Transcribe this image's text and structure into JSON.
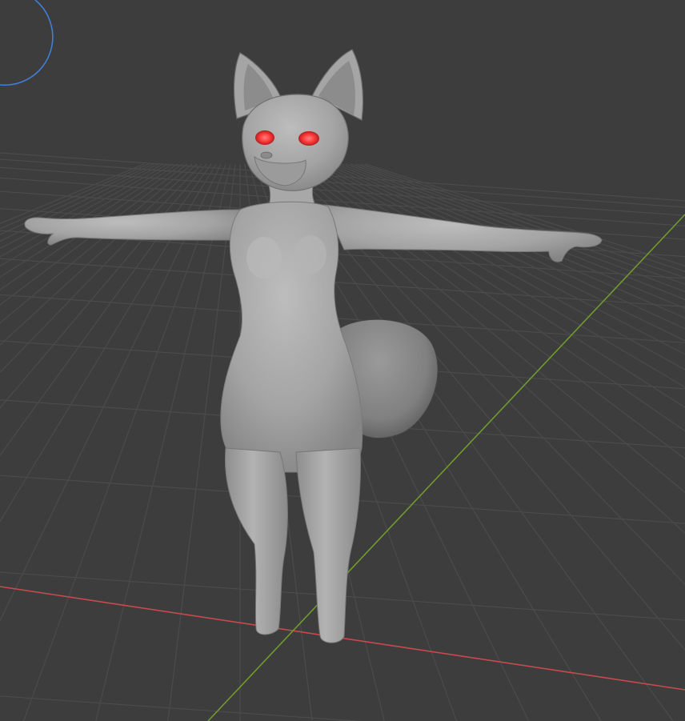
{
  "viewport": {
    "background_color": "#3d3d3d",
    "grid_color": "#4a4a4a",
    "x_axis_color": "#c84a4e",
    "y_axis_color": "#6f9a2e",
    "gizmo_color": "#3f7fd6",
    "model_color": "#a6a6a6",
    "eye_glow_color": "#ff3a3a",
    "shading_mode": "solid",
    "scene_object": "fox-character-base-mesh"
  }
}
